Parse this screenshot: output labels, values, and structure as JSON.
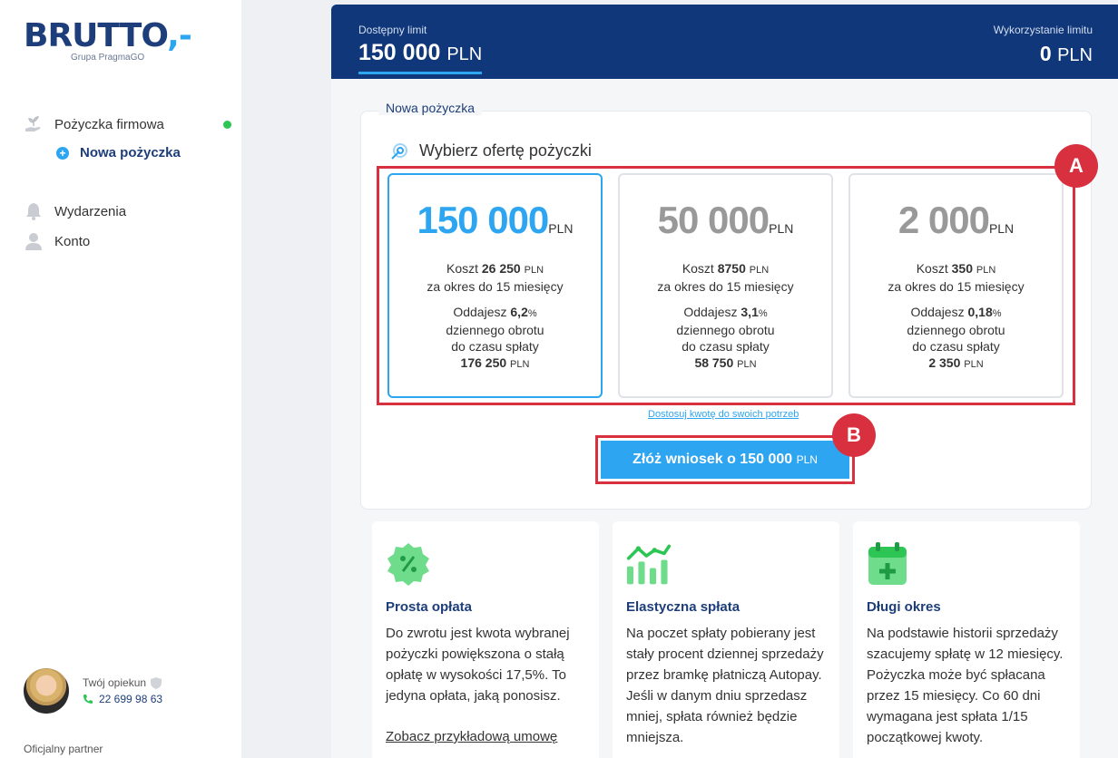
{
  "brand": {
    "logo_text": "BRUTTO",
    "logo_suffix": ",-",
    "logo_sub": "Grupa PragmaGO"
  },
  "sidebar": {
    "items": [
      {
        "label": "Pożyczka firmowa",
        "icon": "plant-hand-icon"
      },
      {
        "label": "Nowa pożyczka",
        "icon": "plus-circle-icon"
      },
      {
        "label": "Wydarzenia",
        "icon": "bell-icon"
      },
      {
        "label": "Konto",
        "icon": "user-icon"
      }
    ],
    "status_color": "#2dc553",
    "caretaker_label": "Twój opiekun",
    "caretaker_phone": "22 699 98 63",
    "partner_label": "Oficjalny partner"
  },
  "header": {
    "available_label": "Dostępny limit",
    "available_value": "150 000",
    "available_unit": "PLN",
    "used_label": "Wykorzystanie limitu",
    "used_value": "0",
    "used_unit": "PLN"
  },
  "card": {
    "tab_label": "Nowa pożyczka",
    "title": "Wybierz ofertę pożyczki",
    "offers": [
      {
        "amount": "150 000",
        "unit": "PLN",
        "cost_prefix": "Koszt",
        "cost": "26 250",
        "period": "za okres do 15 miesięcy",
        "return_prefix": "Oddajesz",
        "percent": "6,2",
        "turnover_line1": "dziennego obrotu",
        "turnover_line2": "do czasu spłaty",
        "total": "176 250",
        "selected": true
      },
      {
        "amount": "50 000",
        "unit": "PLN",
        "cost_prefix": "Koszt",
        "cost": "8750",
        "period": "za okres do 15 miesięcy",
        "return_prefix": "Oddajesz",
        "percent": "3,1",
        "turnover_line1": "dziennego obrotu",
        "turnover_line2": "do czasu spłaty",
        "total": "58 750",
        "selected": false
      },
      {
        "amount": "2 000",
        "unit": "PLN",
        "cost_prefix": "Koszt",
        "cost": "350",
        "period": "za okres do 15 miesięcy",
        "return_prefix": "Oddajesz",
        "percent": "0,18",
        "turnover_line1": "dziennego obrotu",
        "turnover_line2": "do czasu spłaty",
        "total": "2 350",
        "selected": false
      }
    ],
    "adjust_link": "Dostosuj kwotę do swoich potrzeb",
    "submit_label": "Złóż wniosek o 150 000",
    "submit_unit": "PLN",
    "badge_a": "A",
    "badge_b": "B"
  },
  "features": [
    {
      "icon": "percent-badge-icon",
      "title": "Prosta opłata",
      "text": "Do zwrotu jest kwota wybranej pożyczki powiększona o stałą opłatę w wysokości 17,5%. To jedyna opłata, jaką ponosisz.",
      "link": "Zobacz przykładową umowę"
    },
    {
      "icon": "growth-chart-icon",
      "title": "Elastyczna spłata",
      "text": "Na poczet spłaty pobierany jest stały procent dziennej sprzedaży przez bramkę płatniczą Autopay. Jeśli w danym dniu sprzedasz mniej, spłata również będzie mniejsza."
    },
    {
      "icon": "calendar-plus-icon",
      "title": "Długi okres",
      "text": "Na podstawie historii sprzedaży szacujemy spłatę w 12 miesięcy. Pożyczka może być spłacana przez 15 miesięcy. Co 60 dni wymagana jest spłata 1/15 początkowej kwoty."
    }
  ],
  "colors": {
    "primary": "#0f3779",
    "accent": "#2ea5f0",
    "highlight": "#d8303e",
    "feature_green": "#2dc553"
  }
}
